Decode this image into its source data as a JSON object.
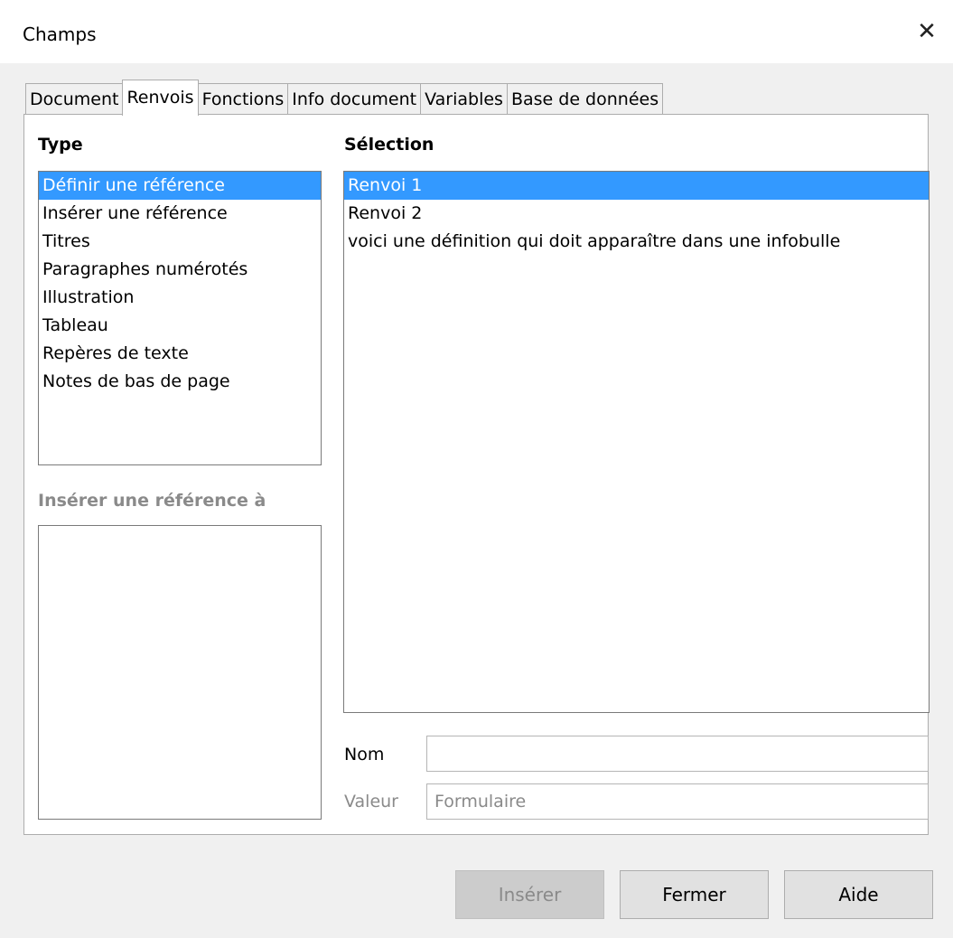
{
  "window": {
    "title": "Champs"
  },
  "tabs": [
    "Document",
    "Renvois",
    "Fonctions",
    "Info document",
    "Variables",
    "Base de données"
  ],
  "type": {
    "label": "Type",
    "items": [
      "Définir une référence",
      "Insérer une référence",
      "Titres",
      "Paragraphes numérotés",
      "Illustration",
      "Tableau",
      "Repères de texte",
      "Notes de bas de page"
    ],
    "selected_index": 0
  },
  "insert_ref": {
    "label": "Insérer une référence à"
  },
  "selection": {
    "label": "Sélection",
    "items": [
      "Renvoi 1",
      "Renvoi 2",
      "voici une définition qui doit apparaître dans une infobulle"
    ],
    "selected_index": 0
  },
  "fields": {
    "name_label": "Nom",
    "name_value": "",
    "value_label": "Valeur",
    "value_value": "Formulaire"
  },
  "buttons": {
    "insert": "Insérer",
    "close": "Fermer",
    "help": "Aide"
  },
  "colors": {
    "selection": "#3399ff",
    "panel": "#ffffff",
    "dialog": "#f0f0f0"
  }
}
